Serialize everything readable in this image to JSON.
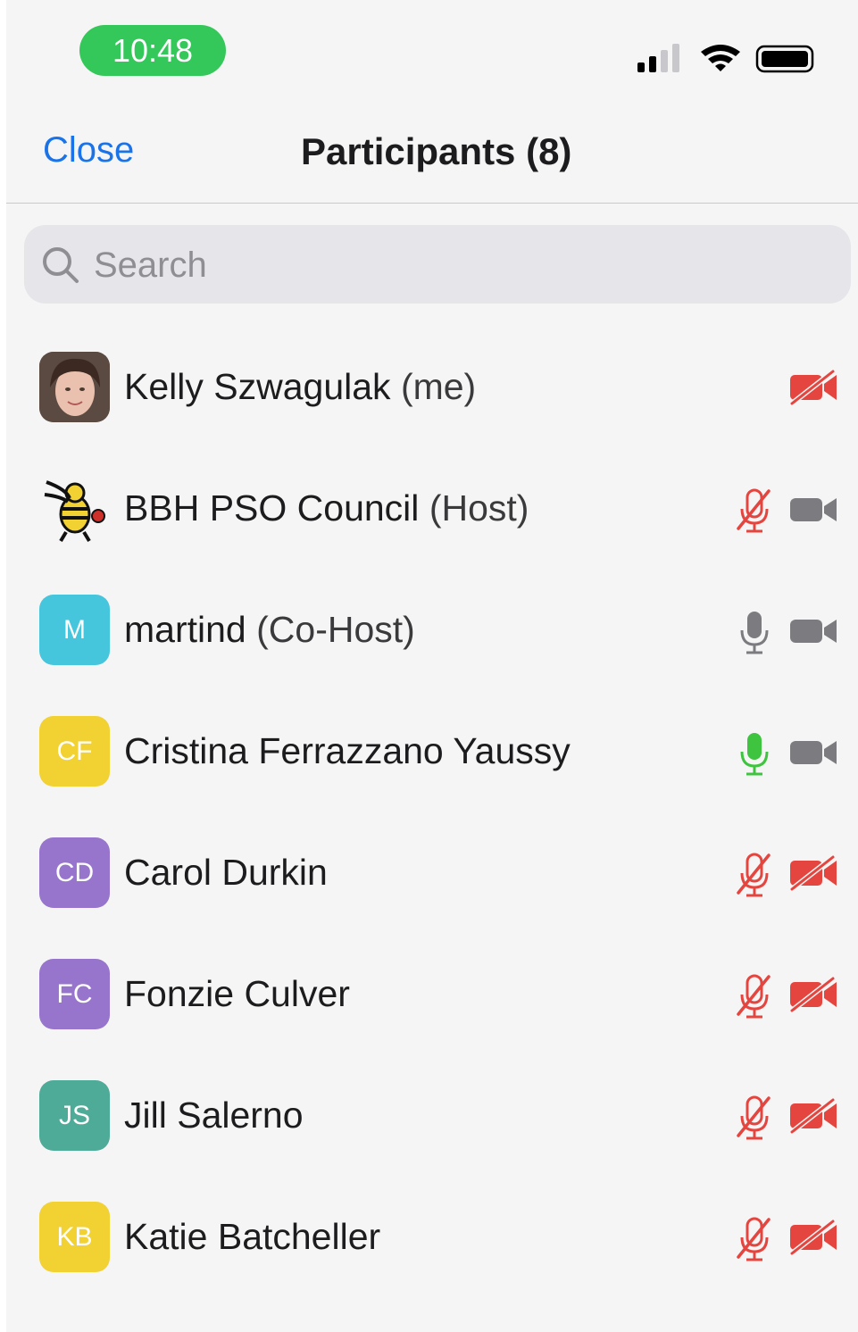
{
  "status_bar": {
    "time": "10:48"
  },
  "header": {
    "close_label": "Close",
    "title": "Participants (8)"
  },
  "search": {
    "placeholder": "Search",
    "value": ""
  },
  "colors": {
    "accent": "#1a73e8",
    "muted_red": "#e5453f",
    "neutral_gray": "#7c7c80",
    "speaking_green": "#3ec43e",
    "time_pill": "#34c759"
  },
  "participants": [
    {
      "name": "Kelly Szwagulak",
      "role": "(me)",
      "initials": "",
      "avatar": "photo",
      "avatar_color": "#8a6a5a",
      "mic": "none",
      "video": "off"
    },
    {
      "name": "BBH PSO Council",
      "role": "(Host)",
      "initials": "",
      "avatar": "logo",
      "avatar_color": "#f5f5f5",
      "mic": "muted",
      "video": "on"
    },
    {
      "name": "martind",
      "role": "(Co-Host)",
      "initials": "M",
      "avatar": "initials",
      "avatar_color": "#45c6dc",
      "mic": "on",
      "video": "on"
    },
    {
      "name": "Cristina Ferrazzano Yaussy",
      "role": "",
      "initials": "CF",
      "avatar": "initials",
      "avatar_color": "#f2d132",
      "mic": "speaking",
      "video": "on"
    },
    {
      "name": "Carol Durkin",
      "role": "",
      "initials": "CD",
      "avatar": "initials",
      "avatar_color": "#9775cd",
      "mic": "muted",
      "video": "off"
    },
    {
      "name": "Fonzie Culver",
      "role": "",
      "initials": "FC",
      "avatar": "initials",
      "avatar_color": "#9775cd",
      "mic": "muted",
      "video": "off"
    },
    {
      "name": "Jill Salerno",
      "role": "",
      "initials": "JS",
      "avatar": "initials",
      "avatar_color": "#4eab98",
      "mic": "muted",
      "video": "off"
    },
    {
      "name": "Katie Batcheller",
      "role": "",
      "initials": "KB",
      "avatar": "initials",
      "avatar_color": "#f2d132",
      "mic": "muted",
      "video": "off"
    }
  ]
}
